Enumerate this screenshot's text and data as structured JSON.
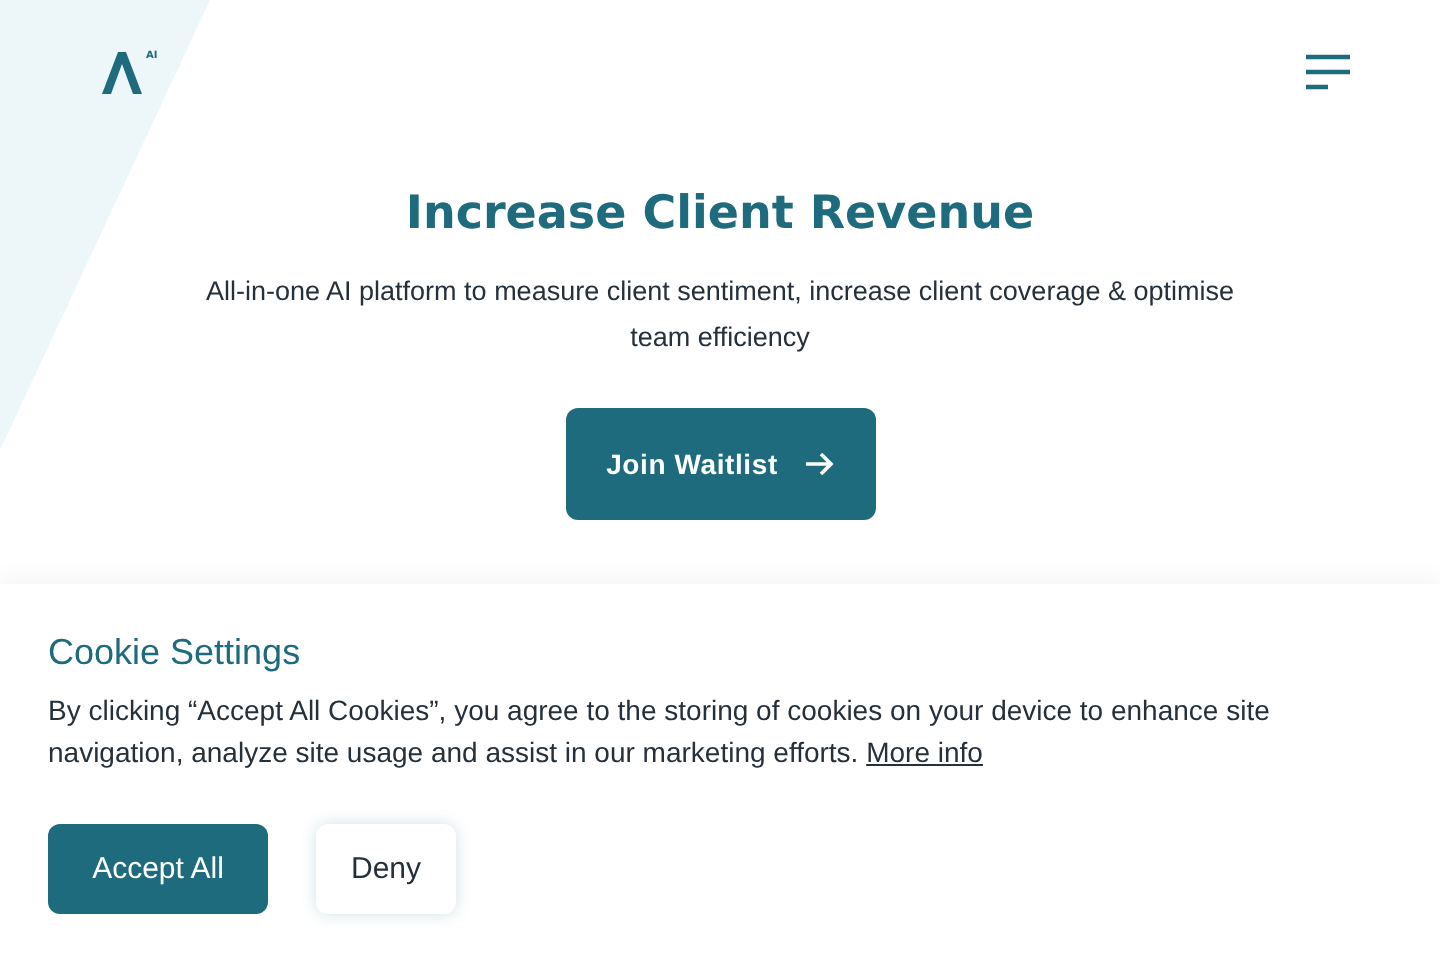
{
  "header": {
    "logo_superscript": "AI"
  },
  "hero": {
    "title": "Increase Client Revenue",
    "subtitle": "All-in-one AI platform to measure client sentiment, increase client coverage & optimise team efficiency",
    "button": "Join Waitlist"
  },
  "cookie_banner": {
    "title": "Cookie Settings",
    "text": "By clicking “Accept All Cookies”, you agree to the storing of cookies on your device to enhance site navigation, analyze site usage and assist in our marketing efforts.",
    "link": "More info",
    "buttons": [
      {
        "label": "Accept All",
        "kind": "primary"
      },
      {
        "label": "Deny",
        "kind": "secondary"
      }
    ]
  }
}
